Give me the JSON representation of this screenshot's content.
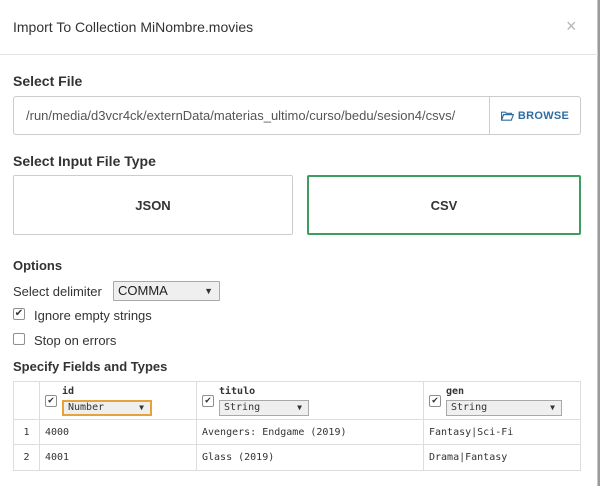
{
  "dialog": {
    "title": "Import To Collection MiNombre.movies",
    "close_glyph": "×"
  },
  "select_file": {
    "label": "Select File",
    "path_value": "/run/media/d3vcr4ck/externData/materias_ultimo/curso/bedu/sesion4/csvs/",
    "browse_label": "BROWSE"
  },
  "file_type": {
    "label": "Select Input File Type",
    "options": [
      {
        "label": "JSON",
        "selected": false
      },
      {
        "label": "CSV",
        "selected": true
      }
    ]
  },
  "options": {
    "label": "Options",
    "delimiter_label": "Select delimiter",
    "delimiter_value": "COMMA",
    "ignore_empty_label": "Ignore empty strings",
    "ignore_empty_checked": true,
    "stop_on_errors_label": "Stop on errors",
    "stop_on_errors_checked": false
  },
  "fields": {
    "label": "Specify Fields and Types",
    "columns": [
      {
        "name": "id",
        "type": "Number",
        "checked": true
      },
      {
        "name": "titulo",
        "type": "String",
        "checked": true
      },
      {
        "name": "gen",
        "type": "String",
        "checked": true
      }
    ],
    "rows": [
      {
        "num": "1",
        "values": [
          "4000",
          "Avengers: Endgame (2019)",
          "Fantasy|Sci-Fi"
        ]
      },
      {
        "num": "2",
        "values": [
          "4001",
          "Glass (2019)",
          "Drama|Fantasy"
        ]
      }
    ]
  },
  "colors": {
    "accent_link": "#2e6da4",
    "selected_border": "#3b9e5e",
    "focus_border": "#e8a23c"
  },
  "icons": {
    "folder": "folder-open-icon",
    "close": "close-icon",
    "dropdown": "caret-down-icon",
    "check": "checkmark-icon"
  }
}
